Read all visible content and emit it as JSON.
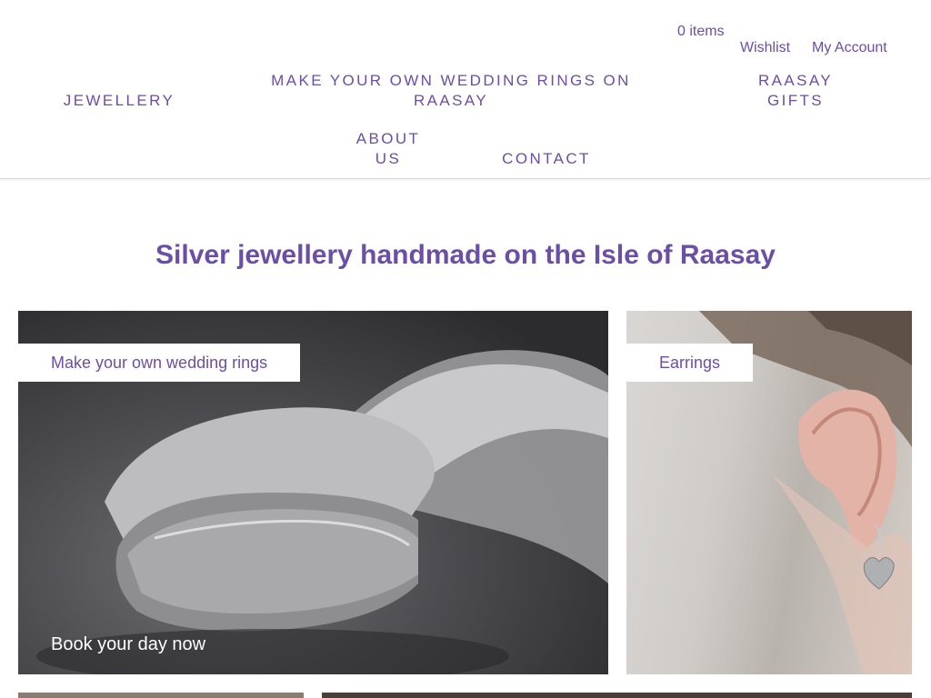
{
  "header": {
    "cart_label": "0 items",
    "wishlist_label": "Wishlist",
    "account_label": "My Account"
  },
  "nav": {
    "jewellery": "JEWELLERY",
    "wedding_rings_line1": "MAKE YOUR OWN WEDDING RINGS ON",
    "wedding_rings_line2": "RAASAY",
    "gifts_line1": "RAASAY",
    "gifts_line2": "GIFTS",
    "about_line1": "ABOUT",
    "about_line2": "US",
    "contact": "CONTACT"
  },
  "main": {
    "headline": "Silver jewellery handmade on the Isle of Raasay",
    "tiles": [
      {
        "label": "Make your own wedding rings",
        "cta": "Book your day now"
      },
      {
        "label": "Earrings"
      }
    ]
  },
  "colors": {
    "accent": "#6b4fa6",
    "background": "#ffffff"
  }
}
